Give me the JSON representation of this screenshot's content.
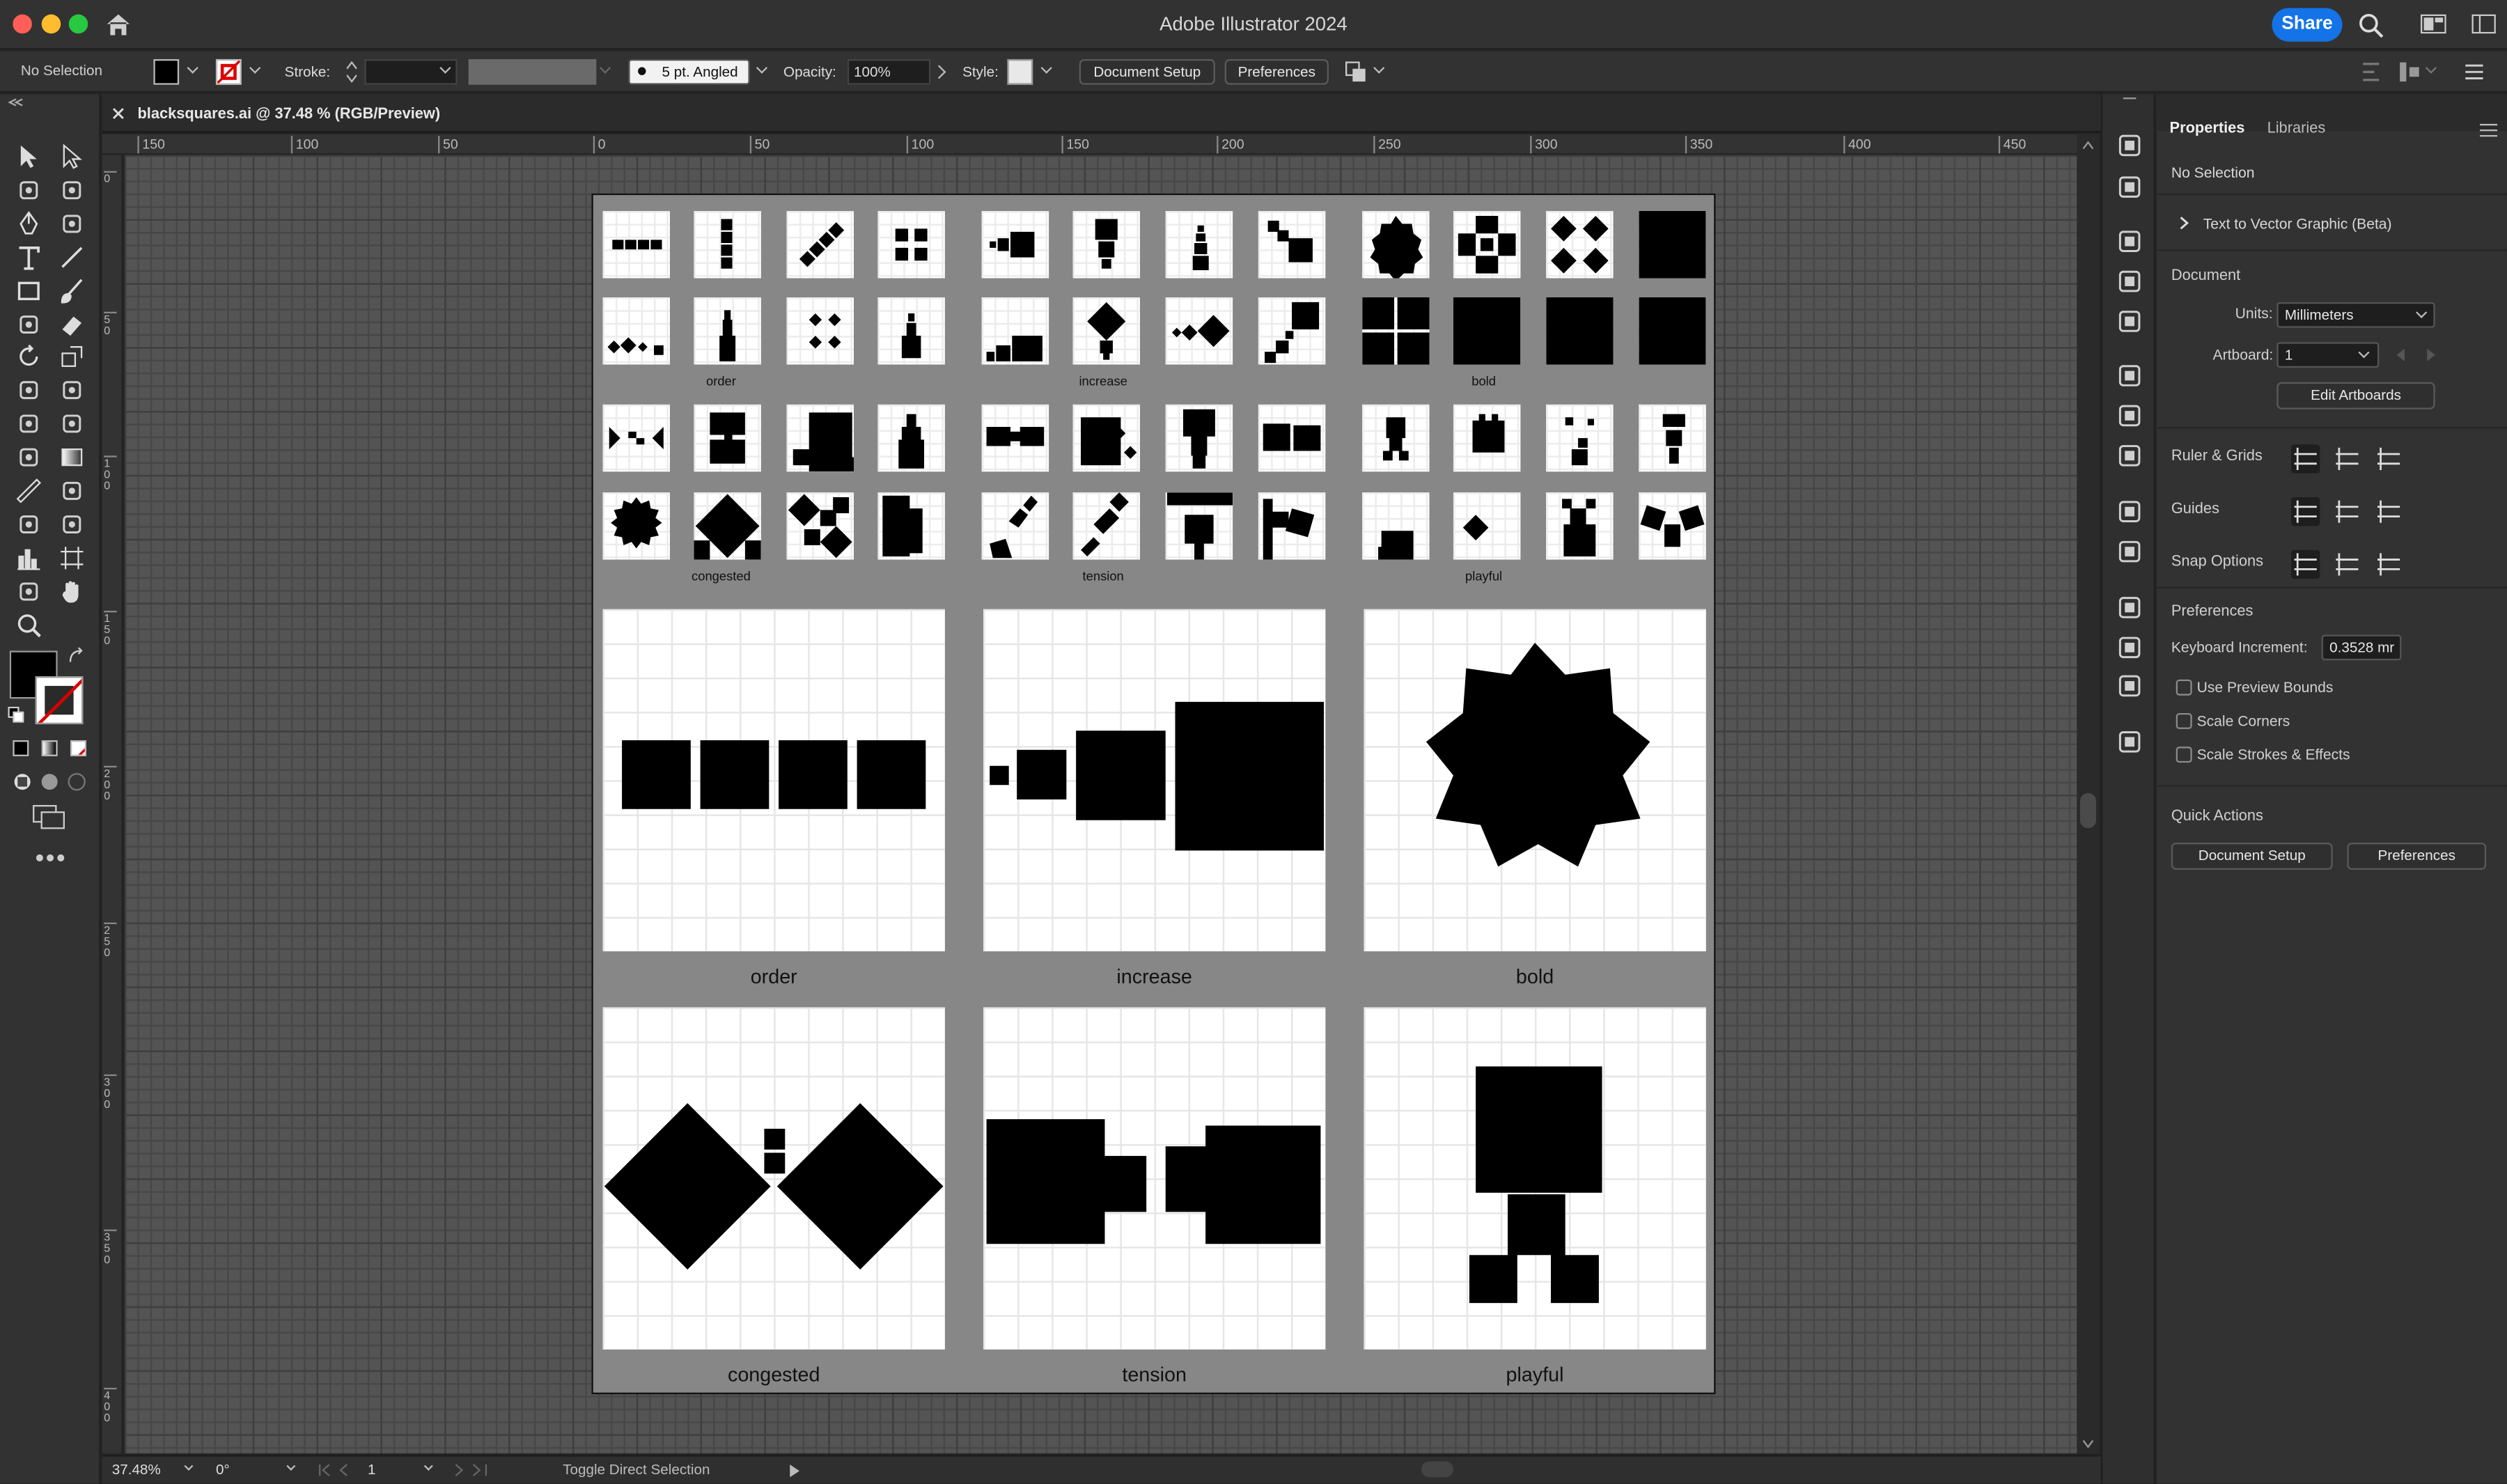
{
  "window": {
    "title": "Adobe Illustrator 2024",
    "share_label": "Share"
  },
  "control_bar": {
    "selection": "No Selection",
    "stroke_label": "Stroke:",
    "brush_label": "5 pt. Angled",
    "opacity_label": "Opacity:",
    "opacity_value": "100%",
    "style_label": "Style:",
    "document_setup": "Document Setup",
    "preferences": "Preferences"
  },
  "document": {
    "tab_title": "blacksquares.ai @ 37.48 % (RGB/Preview)"
  },
  "rulers": {
    "h_ticks": [
      "150",
      "100",
      "50",
      "0",
      "50",
      "100",
      "150",
      "200",
      "250",
      "300",
      "350",
      "400",
      "450"
    ],
    "v_ticks": [
      "0",
      "5 0",
      "1 0 0",
      "1 5 0",
      "2 0 0",
      "2 5 0",
      "3 0 0",
      "3 5 0",
      "4 0 0"
    ]
  },
  "artboard": {
    "group_labels": [
      "order",
      "increase",
      "bold",
      "congested",
      "tension",
      "playful"
    ],
    "big_labels": [
      "order",
      "increase",
      "bold",
      "congested",
      "tension",
      "playful"
    ]
  },
  "status": {
    "zoom": "37.48%",
    "rotation": "0°",
    "artboard_num": "1",
    "tool_hint": "Toggle Direct Selection"
  },
  "panel": {
    "tabs": [
      "Properties",
      "Libraries"
    ],
    "no_selection": "No Selection",
    "text_to_vector": "Text to Vector Graphic (Beta)",
    "document_heading": "Document",
    "units_label": "Units:",
    "units_value": "Millimeters",
    "artboard_label": "Artboard:",
    "artboard_value": "1",
    "edit_artboards": "Edit Artboards",
    "ruler_grids": "Ruler & Grids",
    "guides": "Guides",
    "snap_options": "Snap Options",
    "preferences_heading": "Preferences",
    "keyboard_increment_label": "Keyboard Increment:",
    "keyboard_increment_value": "0.3528 mr",
    "checkboxes": [
      "Use Preview Bounds",
      "Scale Corners",
      "Scale Strokes & Effects"
    ],
    "quick_actions": "Quick Actions",
    "qa_document_setup": "Document Setup",
    "qa_preferences": "Preferences"
  },
  "colors": {
    "accent": "#1473e6",
    "canvas": "#545454",
    "artboard": "#878787"
  }
}
